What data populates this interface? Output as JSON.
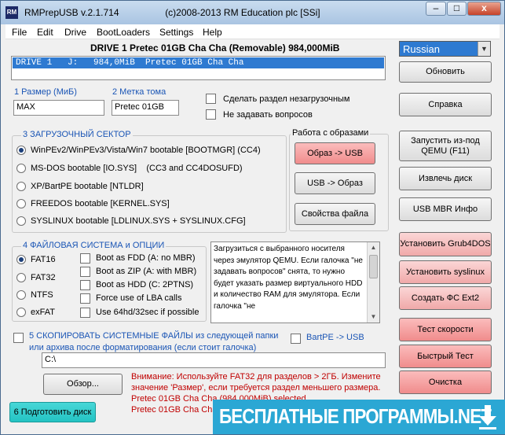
{
  "window": {
    "app_icon_text": "RM",
    "title": "RMPrepUSB v.2.1.714",
    "copyright": "(c)2008-2013 RM Education plc [SSi]",
    "minimize": "–",
    "maximize": "□",
    "close": "x"
  },
  "menu": [
    "File",
    "Edit",
    "Drive",
    "BootLoaders",
    "Settings",
    "Help"
  ],
  "drive": {
    "header": "DRIVE 1  Pretec 01GB Cha Cha  (Removable) 984,000MiB",
    "selected_row": "DRIVE 1   J:   984,0MiB  Pretec 01GB Cha Cha"
  },
  "language": {
    "selected": "Russian"
  },
  "buttons": {
    "refresh": "Обновить",
    "help": "Справка",
    "qemu": "Запустить из-под QEMU (F11)",
    "eject": "Извлечь диск",
    "mbr_info": "USB MBR Инфо",
    "grub4dos": "Установить Grub4DOS",
    "syslinux": "Установить syslinux",
    "ext2": "Создать ФС Ext2",
    "speed_test": "Тест скорости",
    "quick_test": "Быстрый Тест",
    "clean": "Очистка",
    "image_to_usb": "Образ -> USB",
    "usb_to_image": "USB -> Образ",
    "file_props": "Свойства файла",
    "browse": "Обзор...",
    "prepare": "6 Подготовить диск"
  },
  "size": {
    "label": "1 Размер (МиБ)",
    "value": "MAX"
  },
  "volume": {
    "label": "2 Метка тома",
    "value": "Pretec 01GB"
  },
  "options": {
    "non_bootable": "Сделать раздел незагрузочным",
    "no_questions": "Не задавать вопросов"
  },
  "boot_sector": {
    "title": "3 ЗАГРУЗОЧНЫЙ СЕКТОР",
    "items": [
      "WinPEv2/WinPEv3/Vista/Win7 bootable [BOOTMGR] (CC4)",
      "MS-DOS bootable [IO.SYS]    (CC3 and CC4DOSUFD)",
      "XP/BartPE bootable [NTLDR]",
      "FREEDOS bootable [KERNEL.SYS]",
      "SYSLINUX bootable [LDLINUX.SYS + SYSLINUX.CFG]"
    ],
    "selected_index": 0
  },
  "images_group": {
    "title": "Работа с образами"
  },
  "filesystem": {
    "title": "4 ФАЙЛОВАЯ СИСТЕМА и ОПЦИИ",
    "fs": [
      "FAT16",
      "FAT32",
      "NTFS",
      "exFAT"
    ],
    "selected_index": 0,
    "opts": [
      "Boot as FDD (A: no MBR)",
      "Boot as ZIP (A: with MBR)",
      "Boot as HDD (C: 2PTNS)",
      "Force use of LBA calls",
      "Use 64hd/32sec if possible"
    ]
  },
  "info_text": "Загрузиться с выбранного носителя через эмулятор QEMU. Если галочка \"не задавать вопросов\" снята, то нужно будет указать размер виртуального HDD и количество RAM для эмулятора. Если галочка \"не",
  "copy_files": {
    "label_line1": "5 СКОПИРОВАТЬ СИСТЕМНЫЕ ФАЙЛЫ из следующей папки",
    "label_line2": "или архива после форматирования (если стоит галочка)",
    "bartpe": "BartPE -> USB",
    "path": "C:\\"
  },
  "warning": {
    "line1": "Внимание: Используйте FAT32 для разделов > 2ГБ. Измените",
    "line2": "значение 'Размер', если требуется раздел меньшего размера.",
    "line3": "Pretec 01GB Cha Cha (984,000MiB) selected.",
    "line4": "Pretec 01GB Cha Cha (984,000MiB) selected."
  },
  "watermark": {
    "text": "БЕСПЛАТНЫЕ ПРОГРАММЫ.NET"
  },
  "colors": {
    "accent_blue": "#1a55b5",
    "selection": "#2e7ad1",
    "warning_red": "#c00000",
    "watermark_bg": "#2ba7d4"
  }
}
